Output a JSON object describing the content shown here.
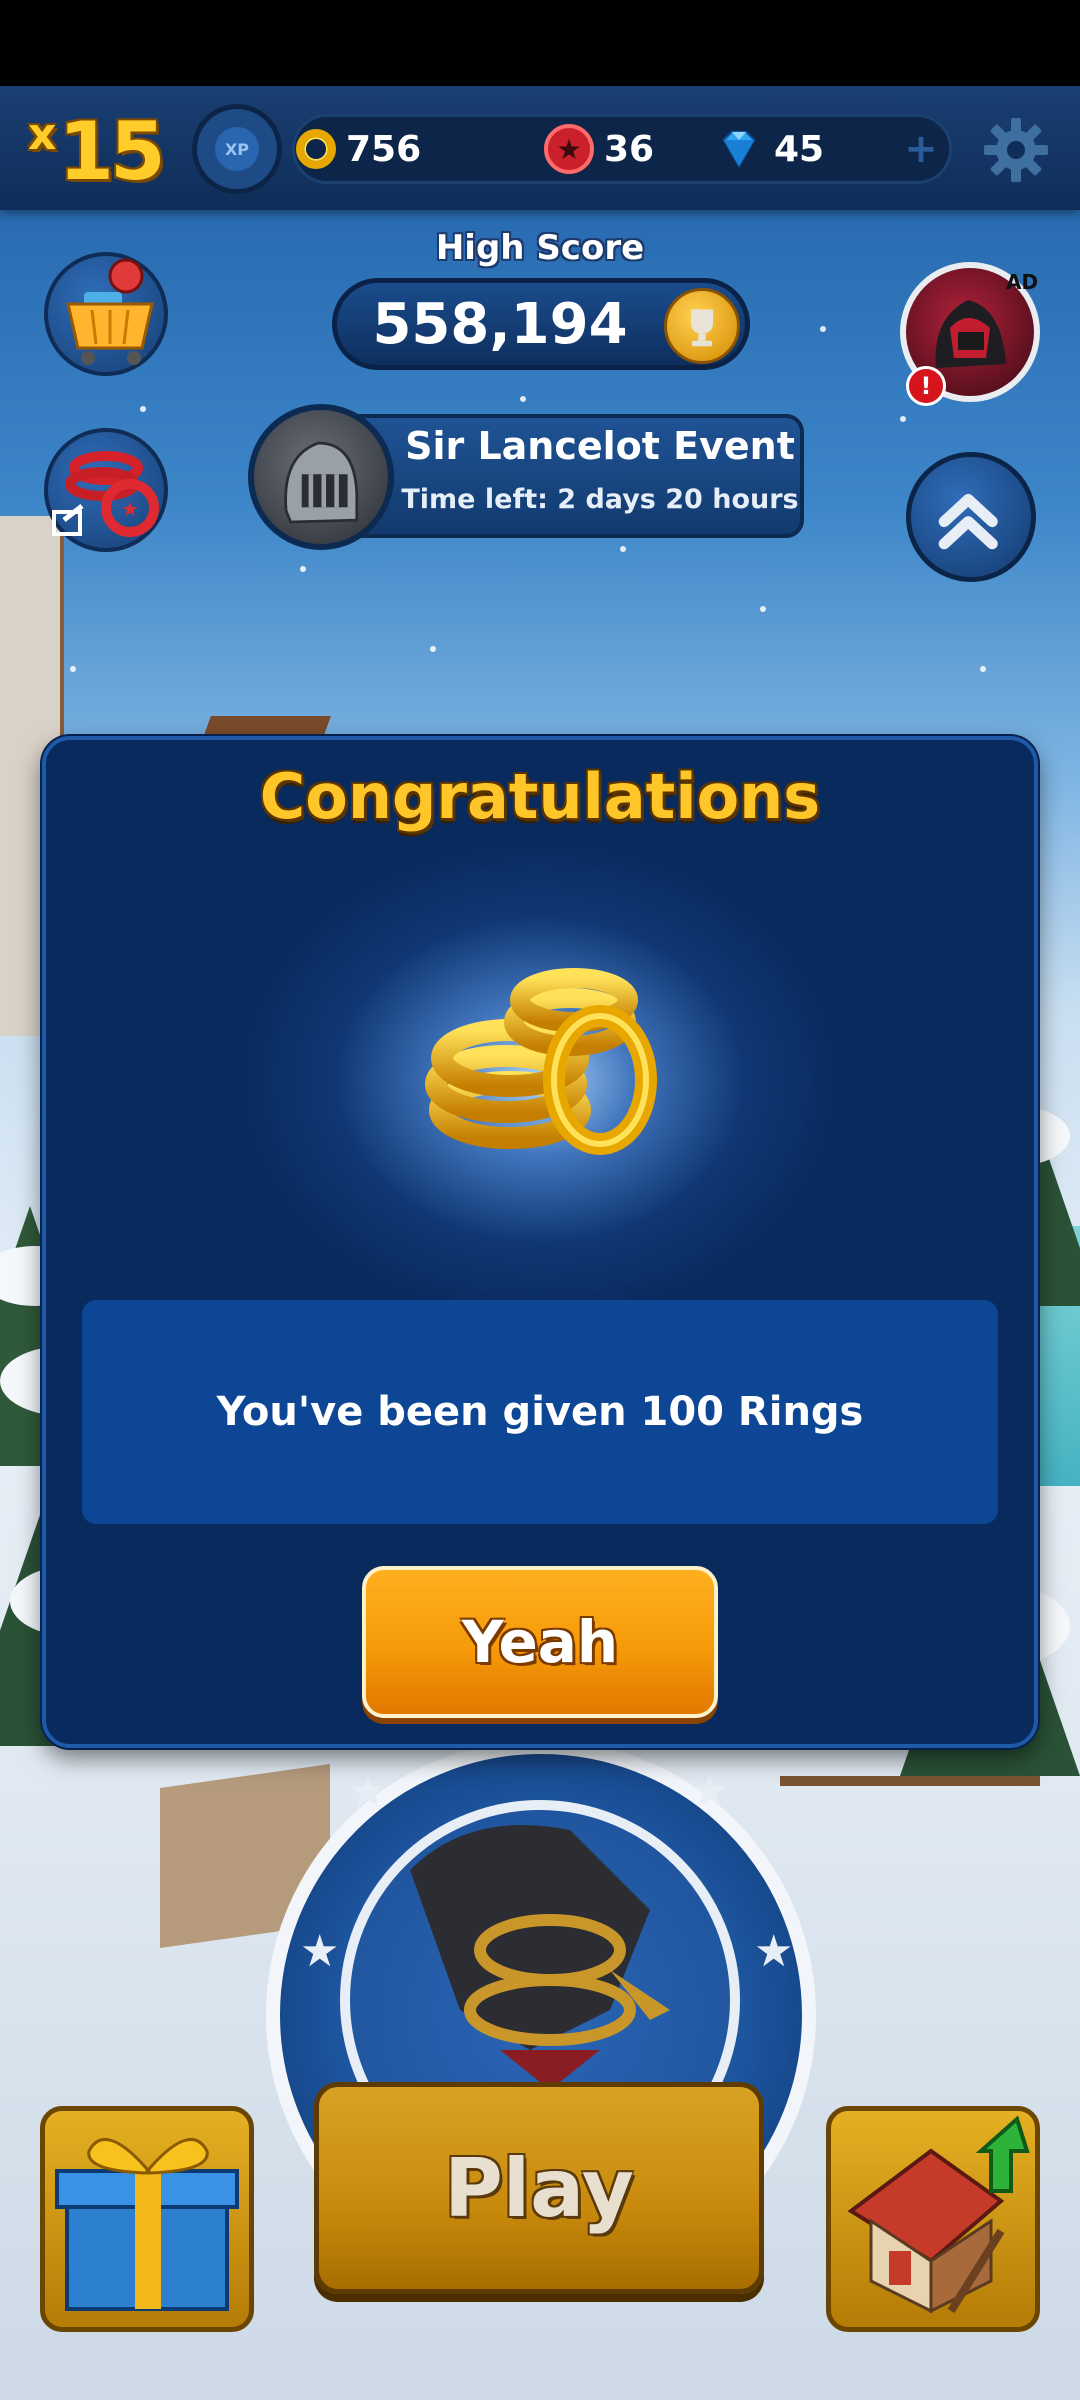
{
  "hud": {
    "multiplier_prefix": "x",
    "multiplier_value": "15",
    "xp_label": "XP",
    "rings": "756",
    "red_star_rings": "36",
    "gems": "45",
    "plus_symbol": "+"
  },
  "high_score": {
    "label": "High Score",
    "value": "558,194"
  },
  "event": {
    "title": "Sir Lancelot Event",
    "time_left": "Time left: 2 days 20 hours"
  },
  "ad_badge": "AD",
  "alert_symbol": "!",
  "modal": {
    "title": "Congratulations",
    "message": "You've been given 100 Rings",
    "confirm_label": "Yeah"
  },
  "play_label": "Play",
  "colors": {
    "modal_bg": "#082a5d",
    "modal_message_bg": "#0e4696",
    "title_gold": "#ffc62a",
    "button_orange": "#f59a09",
    "hud_bar": "#0f2d58"
  },
  "icons": [
    "xp-icon",
    "ring-icon",
    "red-star-ring-icon",
    "gem-icon",
    "plus-icon",
    "gear-icon",
    "shop-cart-icon",
    "share-rings-icon",
    "trophy-icon",
    "knight-avatar-icon",
    "ad-character-icon",
    "alert-icon",
    "chevron-up-icon",
    "gold-rings-icon",
    "gift-icon",
    "house-upgrade-icon",
    "star-icon"
  ]
}
